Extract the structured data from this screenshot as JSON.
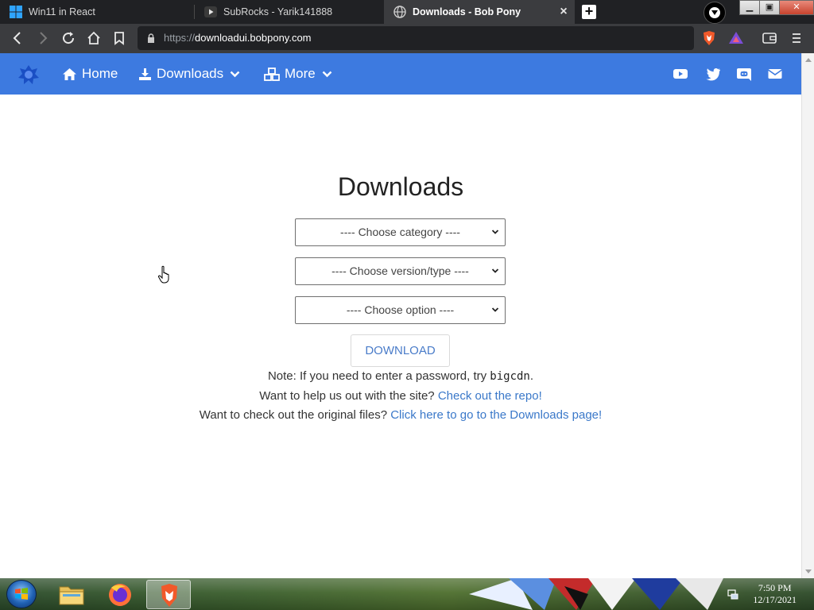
{
  "browser": {
    "tabs": [
      {
        "title": "Win11 in React",
        "active": false
      },
      {
        "title": "SubRocks - Yarik141888",
        "active": false
      },
      {
        "title": "Downloads - Bob Pony",
        "active": true
      }
    ],
    "new_tab_label": "+",
    "close_tab_label": "×",
    "window_buttons": {
      "minimize": "▁",
      "maximize": "▣",
      "close": "✕"
    },
    "url_scheme": "https://",
    "url_host": "downloadui.bobpony.com"
  },
  "site": {
    "nav": {
      "home": "Home",
      "downloads": "Downloads",
      "more": "More"
    },
    "social_icons": [
      "youtube-icon",
      "twitter-icon",
      "discord-icon",
      "mail-icon"
    ],
    "accent_color": "#3d7ae0"
  },
  "main": {
    "heading": "Downloads",
    "category_select": "---- Choose category ----",
    "version_select": "---- Choose version/type ----",
    "option_select": "---- Choose option ----",
    "download_button": "DOWNLOAD",
    "note_prefix": "Note: If you need to enter a password, try ",
    "note_code": "bigcdn",
    "note_suffix": ".",
    "help_text": "Want to help us out with the site? ",
    "help_link": "Check out the repo!",
    "files_text": "Want to check out the original files? ",
    "files_link": "Click here to go to the Downloads page!"
  },
  "taskbar": {
    "apps": [
      "windows-explorer-icon",
      "firefox-icon",
      "brave-icon"
    ],
    "time": "7:50 PM",
    "date": "12/17/2021"
  }
}
